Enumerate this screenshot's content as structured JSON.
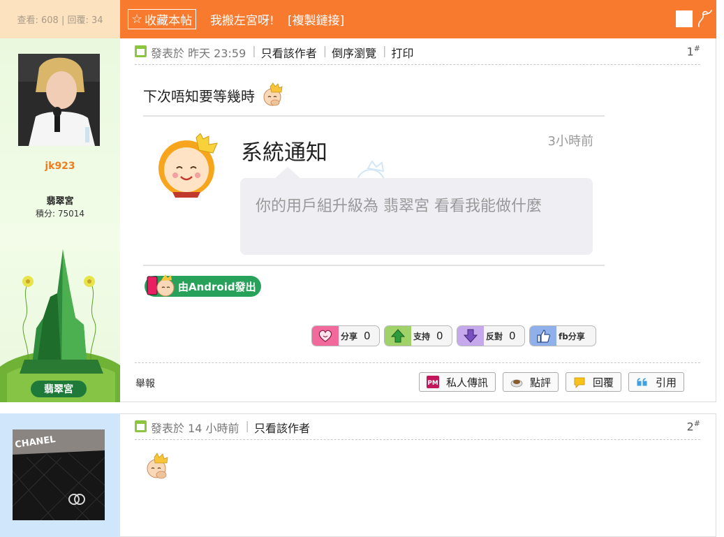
{
  "header": {
    "stats": "查看: 608 | 回覆: 34",
    "favorite_label": "收藏本帖",
    "thread_title": "我搬左宮呀!",
    "copy_link_label": "[複製鏈接]"
  },
  "post1": {
    "username": "jk923",
    "rank": "翡翠宮",
    "points": "積分: 75014",
    "badge_label": "翡翠宮",
    "meta": {
      "posted_label": "發表於 昨天 23:59",
      "only_author": "只看該作者",
      "reverse_view": "倒序瀏覽",
      "print": "打印",
      "floor": "1",
      "floor_mark": "#"
    },
    "message": "下次唔知要等幾時",
    "notification": {
      "title": "系統通知",
      "time": "3小時前",
      "body": "你的用戶組升級為 翡翠宮  看看我能做什麼"
    },
    "android_label": "由Android發出",
    "reactions": [
      {
        "label": "分享",
        "count": "0",
        "color": "#f26a9b"
      },
      {
        "label": "支持",
        "count": "0",
        "color": "#7ac143"
      },
      {
        "label": "反對",
        "count": "0",
        "color": "#a78bd6"
      },
      {
        "label": "fb分享",
        "count": "",
        "color": "#6f8fcf"
      }
    ],
    "report_label": "舉報",
    "actions": {
      "pm": "私人傳訊",
      "rate": "點評",
      "reply": "回覆",
      "quote": "引用"
    }
  },
  "post2": {
    "meta": {
      "posted_label": "發表於 14 小時前",
      "only_author": "只看該作者",
      "floor": "2",
      "floor_mark": "#"
    },
    "avatar_text": "CHANEL"
  },
  "colors": {
    "header_orange": "#f77a2f",
    "username_orange": "#f07c1e",
    "android_green": "#28a25a"
  }
}
